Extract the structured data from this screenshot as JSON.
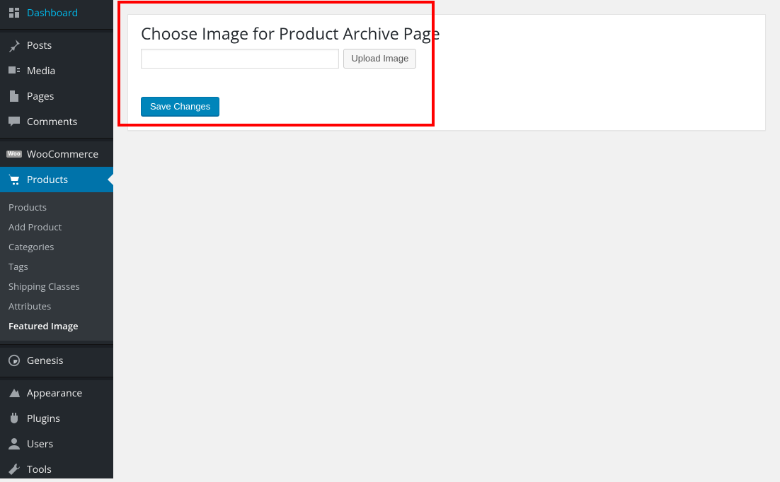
{
  "sidebar": {
    "items": [
      {
        "label": "Dashboard"
      },
      {
        "label": "Posts"
      },
      {
        "label": "Media"
      },
      {
        "label": "Pages"
      },
      {
        "label": "Comments"
      },
      {
        "label": "WooCommerce"
      },
      {
        "label": "Products"
      },
      {
        "label": "Genesis"
      },
      {
        "label": "Appearance"
      },
      {
        "label": "Plugins"
      },
      {
        "label": "Users"
      },
      {
        "label": "Tools"
      }
    ],
    "submenu": [
      {
        "label": "Products"
      },
      {
        "label": "Add Product"
      },
      {
        "label": "Categories"
      },
      {
        "label": "Tags"
      },
      {
        "label": "Shipping Classes"
      },
      {
        "label": "Attributes"
      },
      {
        "label": "Featured Image"
      }
    ]
  },
  "main": {
    "title": "Choose Image for Product Archive Page",
    "upload_button": "Upload Image",
    "save_button": "Save Changes",
    "image_path_value": ""
  },
  "woo_badge": "Woo"
}
